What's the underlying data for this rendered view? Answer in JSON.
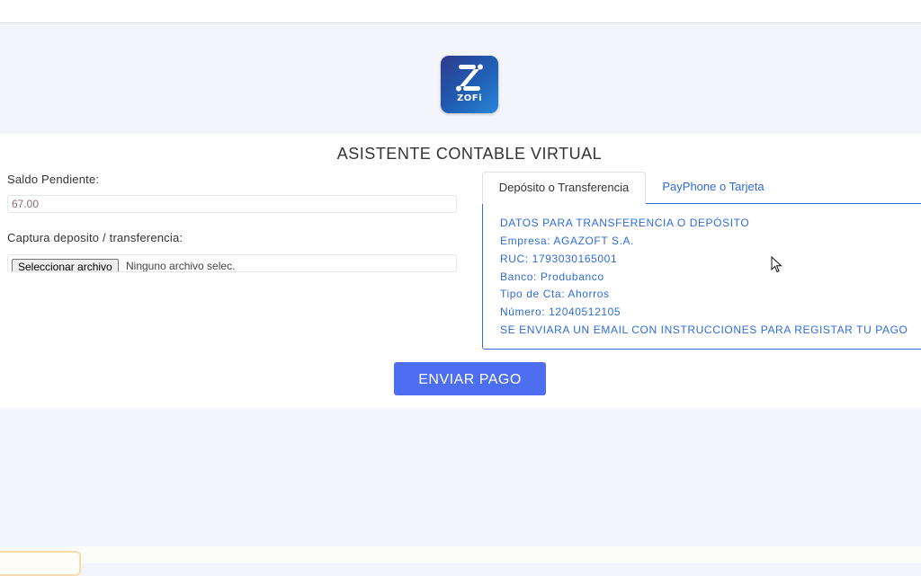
{
  "brand": {
    "logo_text": "ZOFi",
    "logo_gradient": [
      "#2e3a8c",
      "#2a86d8"
    ]
  },
  "page": {
    "title": "ASISTENTE CONTABLE VIRTUAL"
  },
  "form": {
    "saldo_label": "Saldo Pendiente:",
    "saldo_value": "67.00",
    "captura_label": "Captura deposito / transferencia:",
    "file_button_label": "Seleccionar archivo",
    "file_status": "Ninguno archivo selec."
  },
  "tabs": [
    {
      "label": "Depósito o Transferencia",
      "active": true
    },
    {
      "label": "PayPhone o Tarjeta",
      "active": false
    }
  ],
  "transfer_info": {
    "lines": [
      "DATOS PARA TRANSFERENCIA O DEPÓSITO",
      "Empresa: AGAZOFT S.A.",
      "RUC: 1793030165001",
      "Banco: Produbanco",
      "Tipo de Cta: Ahorros",
      "Número: 12040512105",
      "SE ENVIARA UN EMAIL CON INSTRUCCIONES PARA REGISTAR TU PAGO"
    ]
  },
  "actions": {
    "send_label": "ENVIAR PAGO"
  },
  "colors": {
    "accent": "#4e6ef2",
    "link": "#2e6bd9",
    "background": "#f4f5fa"
  }
}
